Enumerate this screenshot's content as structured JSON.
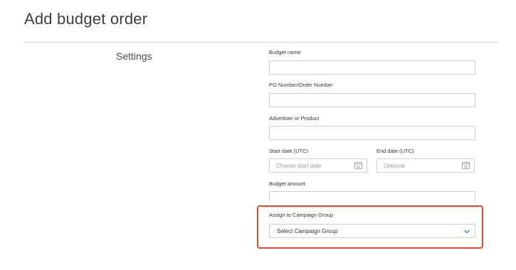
{
  "page": {
    "title": "Add budget order"
  },
  "section": {
    "label": "Settings"
  },
  "fields": {
    "budget_name": {
      "label": "Budget name",
      "value": ""
    },
    "po_number": {
      "label": "PO Number/Order Number",
      "value": ""
    },
    "advertiser": {
      "label": "Advertiser or Product",
      "value": ""
    },
    "start_date": {
      "label": "Start date (UTC)",
      "placeholder": "Choose start date",
      "icon": "calendar-icon",
      "icon_text": "31"
    },
    "end_date": {
      "label": "End date (UTC)",
      "placeholder": "Optional",
      "icon": "calendar-icon",
      "icon_text": "31"
    },
    "budget_amount": {
      "label": "Budget amount",
      "value": ""
    },
    "campaign_group": {
      "label": "Assign to Campaign Group",
      "selected": "Select Campaign Group",
      "icon": "chevron-down-icon"
    }
  },
  "colors": {
    "highlight": "#e8452f",
    "chevron": "#2f7fd6",
    "border": "#cfcfcf"
  }
}
